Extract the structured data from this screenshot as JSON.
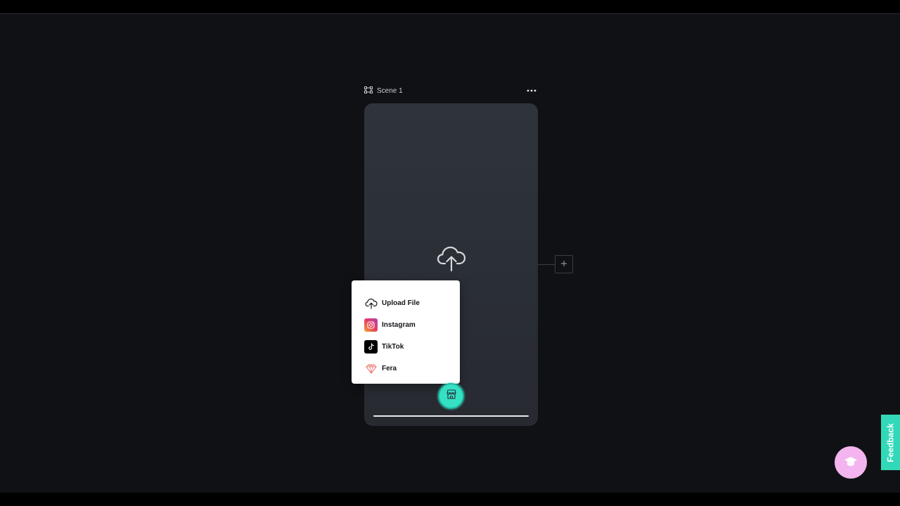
{
  "scene": {
    "title": "Scene 1",
    "icon": "frame-icon",
    "more_icon": "more-horizontal-icon"
  },
  "canvas": {
    "upload_icon": "cloud-upload-icon",
    "add_scene_icon": "plus-icon",
    "colors": {
      "background": "#0f1114",
      "card": "#2f333b"
    }
  },
  "upload_menu": {
    "items": [
      {
        "label": "Upload File",
        "icon": "cloud-upload-icon"
      },
      {
        "label": "Instagram",
        "icon": "instagram-icon"
      },
      {
        "label": "TikTok",
        "icon": "tiktok-icon"
      },
      {
        "label": "Fera",
        "icon": "fera-icon"
      }
    ]
  },
  "floating": {
    "store_icon": "store-icon",
    "store_color": "#35e0c4",
    "learn_icon": "graduation-cap-icon",
    "learn_color": "#f3b4ef",
    "feedback_label": "Feedback",
    "feedback_color": "#32d9b8"
  }
}
